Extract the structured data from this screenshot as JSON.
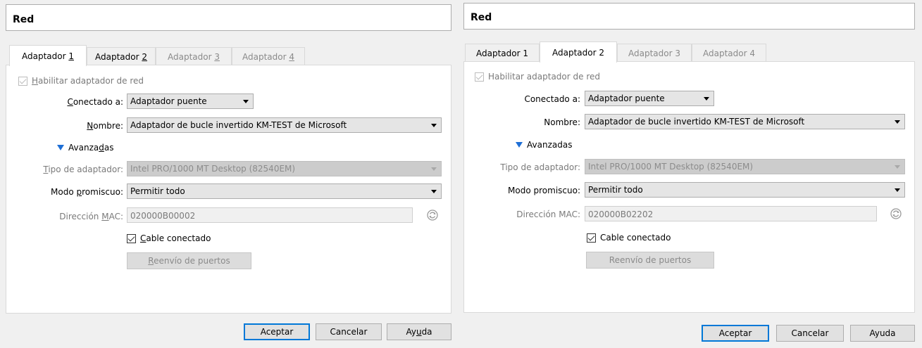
{
  "dialogs": [
    {
      "title": "Red",
      "tabs": [
        {
          "pre": "Adaptador ",
          "key": "1",
          "active": true,
          "disabled": false
        },
        {
          "pre": "Adaptador ",
          "key": "2",
          "active": false,
          "disabled": false
        },
        {
          "pre": "Adaptador ",
          "key": "3",
          "active": false,
          "disabled": true
        },
        {
          "pre": "Adaptador ",
          "key": "4",
          "active": false,
          "disabled": true
        }
      ],
      "enable_adapter": {
        "pre": "",
        "key": "H",
        "post": "abilitar adaptador de red",
        "checked": true
      },
      "attached_to": {
        "pre": "",
        "key": "C",
        "post": "onectado a:",
        "value": "Adaptador puente"
      },
      "name": {
        "pre": "",
        "key": "N",
        "post": "ombre:",
        "value": "Adaptador de bucle invertido KM-TEST de Microsoft"
      },
      "advanced": {
        "pre": "Avanza",
        "key": "d",
        "post": "as"
      },
      "adapter_type": {
        "pre": "",
        "key": "T",
        "post": "ipo de adaptador:",
        "value": "Intel PRO/1000 MT Desktop (82540EM)"
      },
      "promiscuous": {
        "pre": "Modo ",
        "key": "p",
        "post": "romiscuo:",
        "value": "Permitir todo"
      },
      "mac": {
        "pre": "Dirección ",
        "key": "M",
        "post": "AC:",
        "value": "020000B00002"
      },
      "cable": {
        "pre": "",
        "key": "C",
        "post": "able conectado",
        "checked": true
      },
      "port_forwarding": {
        "pre": "",
        "key": "R",
        "post": "eenvío de puertos"
      },
      "buttons": {
        "ok": {
          "pre": "Aceptar",
          "key": "",
          "post": ""
        },
        "cancel": {
          "pre": "Cancelar",
          "key": "",
          "post": ""
        },
        "help": {
          "pre": "Ay",
          "key": "u",
          "post": "da"
        }
      }
    },
    {
      "title": "Red",
      "tabs": [
        {
          "pre": "Adaptador 1",
          "key": "",
          "active": false,
          "disabled": false
        },
        {
          "pre": "Adaptador 2",
          "key": "",
          "active": true,
          "disabled": false
        },
        {
          "pre": "Adaptador 3",
          "key": "",
          "active": false,
          "disabled": true
        },
        {
          "pre": "Adaptador 4",
          "key": "",
          "active": false,
          "disabled": true
        }
      ],
      "enable_adapter": {
        "pre": "Habilitar adaptador de red",
        "key": "",
        "post": "",
        "checked": true
      },
      "attached_to": {
        "pre": "Conectado a:",
        "key": "",
        "post": "",
        "value": "Adaptador puente"
      },
      "name": {
        "pre": "Nombre:",
        "key": "",
        "post": "",
        "value": "Adaptador de bucle invertido KM-TEST de Microsoft"
      },
      "advanced": {
        "pre": "Avanzadas",
        "key": "",
        "post": ""
      },
      "adapter_type": {
        "pre": "Tipo de adaptador:",
        "key": "",
        "post": "",
        "value": "Intel PRO/1000 MT Desktop (82540EM)"
      },
      "promiscuous": {
        "pre": "Modo promiscuo:",
        "key": "",
        "post": "",
        "value": "Permitir todo"
      },
      "mac": {
        "pre": "Dirección MAC:",
        "key": "",
        "post": "",
        "value": "020000B02202"
      },
      "cable": {
        "pre": "Cable conectado",
        "key": "",
        "post": "",
        "checked": true
      },
      "port_forwarding": {
        "pre": "Reenvío de puertos",
        "key": "",
        "post": ""
      },
      "buttons": {
        "ok": {
          "pre": "Aceptar",
          "key": "",
          "post": ""
        },
        "cancel": {
          "pre": "Cancelar",
          "key": "",
          "post": ""
        },
        "help": {
          "pre": "Ayuda",
          "key": "",
          "post": ""
        }
      }
    }
  ]
}
